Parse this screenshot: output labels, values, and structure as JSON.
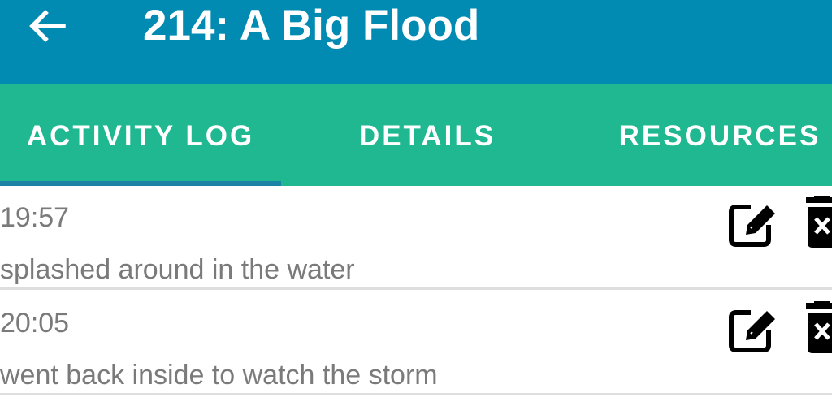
{
  "app_bar": {
    "title": "214: A Big Flood",
    "back_icon": "arrow-left-icon",
    "background_color": "#018bb2"
  },
  "tabs": {
    "background_color": "#1fb890",
    "indicator_color": "#1c82a6",
    "items": [
      {
        "label": "ACTIVITY LOG",
        "selected": true
      },
      {
        "label": "DETAILS",
        "selected": false
      },
      {
        "label": "RESOURCES",
        "selected": false
      }
    ]
  },
  "activity_log": {
    "entries": [
      {
        "time": "19:57",
        "text": "splashed around in the water",
        "edit_icon": "edit-icon",
        "delete_icon": "trash-icon"
      },
      {
        "time": "20:05",
        "text": "went back inside to watch the storm",
        "edit_icon": "edit-icon",
        "delete_icon": "trash-icon"
      }
    ]
  }
}
